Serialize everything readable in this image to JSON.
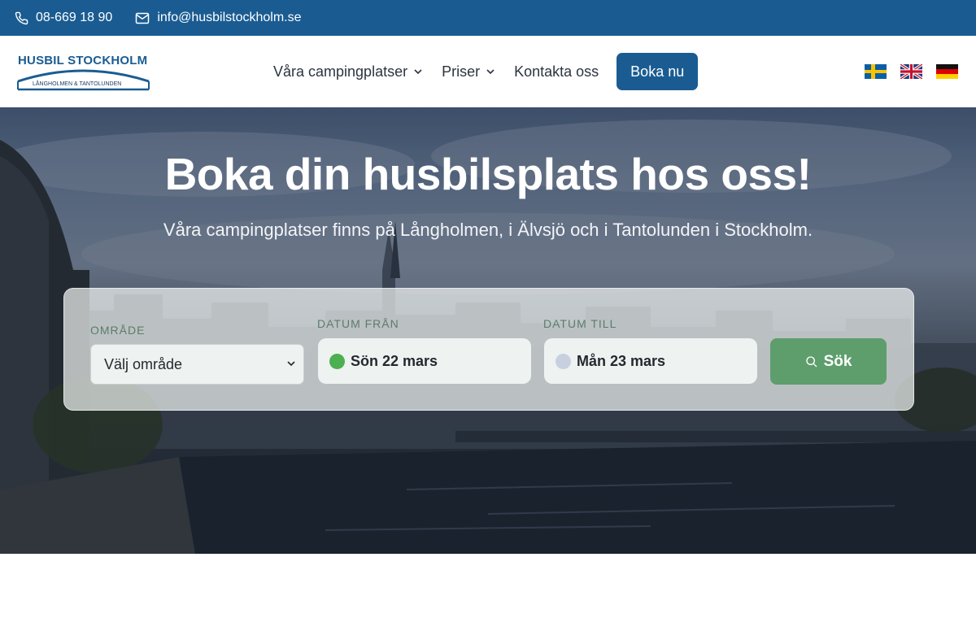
{
  "topbar": {
    "phone": "08-669 18 90",
    "email": "info@husbilstockholm.se",
    "phone_icon": "phone-icon",
    "email_icon": "mail-icon"
  },
  "logo": {
    "title": "HUSBIL STOCKHOLM",
    "subtitle": "LÅNGHOLMEN & TANTOLUNDEN"
  },
  "nav": {
    "items": [
      {
        "label": "Våra campingplatser",
        "has_dropdown": true
      },
      {
        "label": "Priser",
        "has_dropdown": true
      },
      {
        "label": "Kontakta oss",
        "has_dropdown": false
      }
    ],
    "cta": "Boka nu"
  },
  "languages": [
    "Svenska",
    "English",
    "Deutsch"
  ],
  "hero": {
    "title": "Boka din husbilsplats hos oss!",
    "subtitle": "Våra campingplatser finns på Långholmen, i Älvsjö och i Tantolunden i Stockholm."
  },
  "search": {
    "area_label": "OMRÅDE",
    "area_value": "Välj område",
    "from_label": "DATUM FRÅN",
    "from_value": "Sön 22 mars",
    "to_label": "DATUM TILL",
    "to_value": "Mån 23 mars",
    "button": "Sök"
  },
  "colors": {
    "primary": "#1a5c92",
    "search_button": "#5e9e6c",
    "from_dot": "#4caf50",
    "to_dot": "#c8d0e0"
  }
}
